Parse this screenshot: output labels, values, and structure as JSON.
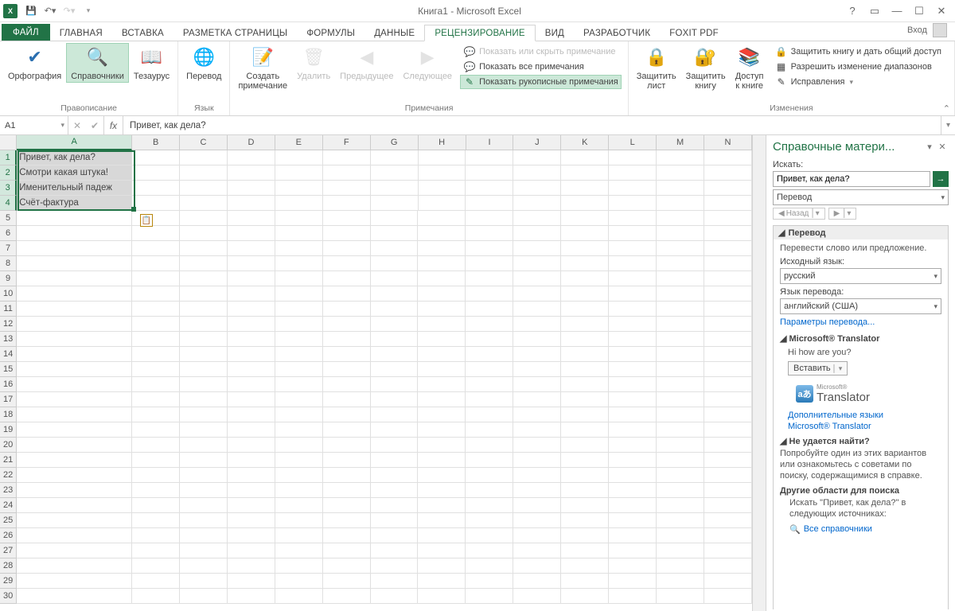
{
  "titlebar": {
    "title": "Книга1 - Microsoft Excel",
    "login": "Вход"
  },
  "tabs": {
    "file": "ФАЙЛ",
    "items": [
      "ГЛАВНАЯ",
      "ВСТАВКА",
      "РАЗМЕТКА СТРАНИЦЫ",
      "ФОРМУЛЫ",
      "ДАННЫЕ",
      "РЕЦЕНЗИРОВАНИЕ",
      "ВИД",
      "РАЗРАБОТЧИК",
      "FOXIT PDF"
    ],
    "active_index": 5
  },
  "ribbon": {
    "spelling": {
      "label": "Правописание",
      "orthography": "Орфография",
      "references": "Справочники",
      "thesaurus": "Тезаурус"
    },
    "language": {
      "label": "Язык",
      "translate": "Перевод"
    },
    "comments": {
      "label": "Примечания",
      "new": "Создать\nпримечание",
      "delete": "Удалить",
      "prev": "Предыдущее",
      "next": "Следующее",
      "show_hide": "Показать или скрыть примечание",
      "show_all": "Показать все примечания",
      "show_ink": "Показать рукописные примечания"
    },
    "changes": {
      "label": "Изменения",
      "protect_sheet": "Защитить\nлист",
      "protect_book": "Защитить\nкнигу",
      "share": "Доступ\nк книге",
      "protect_share": "Защитить книгу и дать общий доступ",
      "allow_ranges": "Разрешить изменение диапазонов",
      "track": "Исправления"
    }
  },
  "formula_bar": {
    "name": "A1",
    "value": "Привет, как дела?"
  },
  "columns": [
    "A",
    "B",
    "C",
    "D",
    "E",
    "F",
    "G",
    "H",
    "I",
    "J",
    "K",
    "L",
    "M",
    "N"
  ],
  "cells": {
    "a1": "Привет, как дела?",
    "a2": "Смотри какая штука!",
    "a3": "Именительный падеж",
    "a4": "Счёт-фактура"
  },
  "pane": {
    "title": "Справочные матери...",
    "search_label": "Искать:",
    "search_value": "Привет, как дела?",
    "scope": "Перевод",
    "back": "Назад",
    "translate_head": "Перевод",
    "translate_desc": "Перевести слово или предложение.",
    "src_label": "Исходный язык:",
    "src_value": "русский",
    "tgt_label": "Язык перевода:",
    "tgt_value": "английский (США)",
    "options_link": "Параметры перевода...",
    "ms_translator_head": "Microsoft® Translator",
    "result": "Hi how are you?",
    "insert": "Вставить",
    "translator_brand_small": "Microsoft®",
    "translator_brand": "Translator",
    "more_langs": "Дополнительные языки",
    "ms_link": "Microsoft® Translator",
    "cant_find_head": "Не удается найти?",
    "cant_find_text": "Попробуйте один из этих вариантов или ознакомьтесь с советами по поиску, содержащимися в справке.",
    "other_areas": "Другие области для поиска",
    "search_in": "Искать \"Привет, как дела?\" в следующих источниках:",
    "all_refs": "Все справочники"
  }
}
